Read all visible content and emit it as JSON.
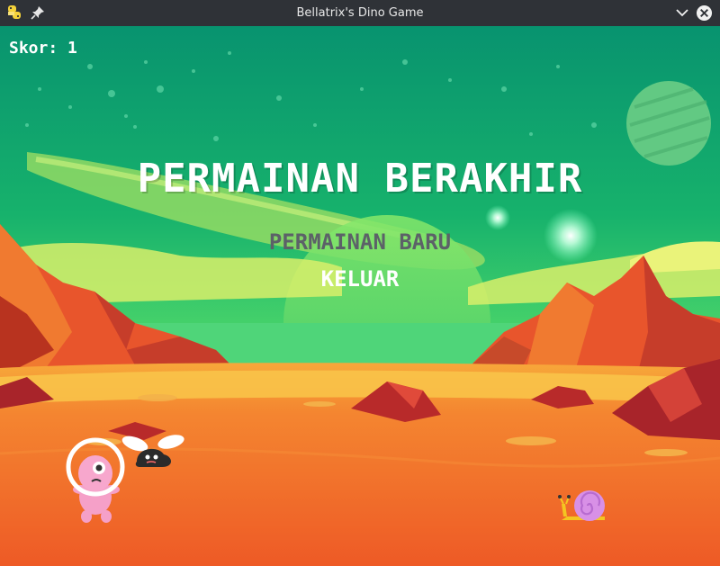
{
  "window": {
    "title": "Bellatrix's Dino Game"
  },
  "hud": {
    "score_text": "Skor: 1"
  },
  "menu": {
    "heading": "PERMAINAN BERAKHIR",
    "items": [
      {
        "label": "PERMAINAN BARU",
        "state": "unselected"
      },
      {
        "label": "KELUAR",
        "state": "selected"
      }
    ]
  },
  "scene": {
    "setting": "alien planet landscape",
    "sprites": [
      "pink-astronaut-alien",
      "black-fly-monster",
      "yellow-snail-with-pink-shell"
    ]
  },
  "colors": {
    "sky_top": "#0b9e72",
    "sky_mid": "#25c06a",
    "ground": "#f06a2a",
    "menu_selected": "#ffffff",
    "menu_unselected": "#5c6168"
  },
  "icons": {
    "app": "python-icon",
    "pin": "pin-icon",
    "minimize": "chevron-down-icon",
    "close": "close-icon"
  }
}
